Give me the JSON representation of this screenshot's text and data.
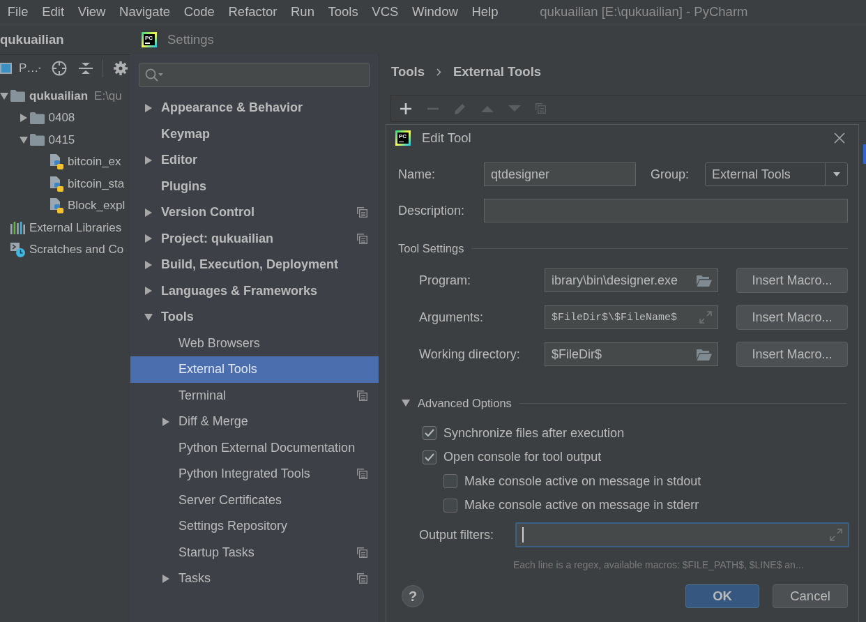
{
  "menu_bar": {
    "items": [
      "File",
      "Edit",
      "View",
      "Navigate",
      "Code",
      "Refactor",
      "Run",
      "Tools",
      "VCS",
      "Window",
      "Help"
    ],
    "title": "qukuailian [E:\\qukuailian] - PyCharm"
  },
  "project_panel": {
    "title": "qukuailian",
    "view_selector": "P…",
    "tree": [
      {
        "label": "qukuailian",
        "path": "E:\\qu",
        "kind": "module",
        "expanded": true,
        "children": [
          {
            "label": "0408",
            "kind": "folder",
            "expanded": false
          },
          {
            "label": "0415",
            "kind": "folder",
            "expanded": true,
            "children": [
              {
                "label": "bitcoin_ex",
                "kind": "python"
              },
              {
                "label": "bitcoin_sta",
                "kind": "python"
              },
              {
                "label": "Block_expl",
                "kind": "python"
              }
            ]
          }
        ]
      },
      {
        "label": "External Libraries",
        "kind": "libraries"
      },
      {
        "label": "Scratches and Co",
        "kind": "scratches"
      }
    ]
  },
  "settings_window": {
    "logo_text": "PC",
    "title": "Settings",
    "sidebar": {
      "items": [
        {
          "label": "Appearance & Behavior",
          "kind": "group",
          "expanded": false,
          "shared": false,
          "selected": false
        },
        {
          "label": "Keymap",
          "kind": "page",
          "shared": false,
          "selected": false
        },
        {
          "label": "Editor",
          "kind": "group",
          "expanded": false,
          "shared": false,
          "selected": false
        },
        {
          "label": "Plugins",
          "kind": "page",
          "shared": false,
          "selected": false
        },
        {
          "label": "Version Control",
          "kind": "group",
          "expanded": false,
          "shared": true,
          "selected": false
        },
        {
          "label": "Project: qukuailian",
          "kind": "group",
          "expanded": false,
          "shared": true,
          "selected": false
        },
        {
          "label": "Build, Execution, Deployment",
          "kind": "group",
          "expanded": false,
          "shared": false,
          "selected": false
        },
        {
          "label": "Languages & Frameworks",
          "kind": "group",
          "expanded": false,
          "shared": false,
          "selected": false
        },
        {
          "label": "Tools",
          "kind": "group",
          "expanded": true,
          "shared": false,
          "selected": false,
          "children": [
            {
              "label": "Web Browsers",
              "kind": "page",
              "shared": false,
              "selected": false
            },
            {
              "label": "External Tools",
              "kind": "page",
              "shared": false,
              "selected": true
            },
            {
              "label": "Terminal",
              "kind": "page",
              "shared": true,
              "selected": false
            },
            {
              "label": "Diff & Merge",
              "kind": "group",
              "expanded": false,
              "shared": false,
              "selected": false
            },
            {
              "label": "Python External Documentation",
              "kind": "page",
              "shared": false,
              "selected": false
            },
            {
              "label": "Python Integrated Tools",
              "kind": "page",
              "shared": true,
              "selected": false
            },
            {
              "label": "Server Certificates",
              "kind": "page",
              "shared": false,
              "selected": false
            },
            {
              "label": "Settings Repository",
              "kind": "page",
              "shared": false,
              "selected": false
            },
            {
              "label": "Startup Tasks",
              "kind": "page",
              "shared": true,
              "selected": false
            },
            {
              "label": "Tasks",
              "kind": "group",
              "expanded": false,
              "shared": true,
              "selected": false
            }
          ]
        }
      ]
    },
    "breadcrumb": [
      "Tools",
      "External Tools"
    ],
    "toolbar": [
      {
        "kind": "add",
        "disabled": false
      },
      {
        "kind": "remove",
        "disabled": true
      },
      {
        "kind": "edit",
        "disabled": true
      },
      {
        "kind": "move_up",
        "disabled": true
      },
      {
        "kind": "move_down",
        "disabled": true
      },
      {
        "kind": "copy",
        "disabled": true
      }
    ]
  },
  "edit_tool_dialog": {
    "logo_text": "PC",
    "title": "Edit Tool",
    "name_field": {
      "label": "Name:",
      "value": "qtdesigner"
    },
    "group_field": {
      "label": "Group:",
      "value": "External Tools"
    },
    "description_field": {
      "label": "Description:"
    },
    "tool_settings": {
      "title": "Tool Settings",
      "fields": [
        {
          "label": "Program:",
          "value": "ibrary\\bin\\designer.exe",
          "kind": "browse",
          "macro_button": "Insert Macro..."
        },
        {
          "label": "Arguments:",
          "value": "$FileDir$\\$FileName$",
          "kind": "expand",
          "macro_button": "Insert Macro..."
        },
        {
          "label": "Working directory:",
          "value": "$FileDir$",
          "kind": "browse",
          "macro_button": "Insert Macro..."
        }
      ]
    },
    "advanced_options": {
      "title": "Advanced Options",
      "expanded": true,
      "options": [
        {
          "label": "Synchronize files after execution",
          "checked": true
        },
        {
          "label": "Open console for tool output",
          "checked": true,
          "children": [
            {
              "label": "Make console active on message in stdout",
              "checked": false
            },
            {
              "label": "Make console active on message in stderr",
              "checked": false
            }
          ]
        }
      ],
      "output_filters": {
        "label": "Output filters:",
        "focused": true
      },
      "hint": "Each line is a regex, available macros: $FILE_PATH$, $LINE$ an..."
    },
    "help_button": "?",
    "buttons": [
      {
        "label": "OK",
        "kind": "primary"
      },
      {
        "label": "Cancel",
        "kind": "secondary"
      }
    ]
  }
}
